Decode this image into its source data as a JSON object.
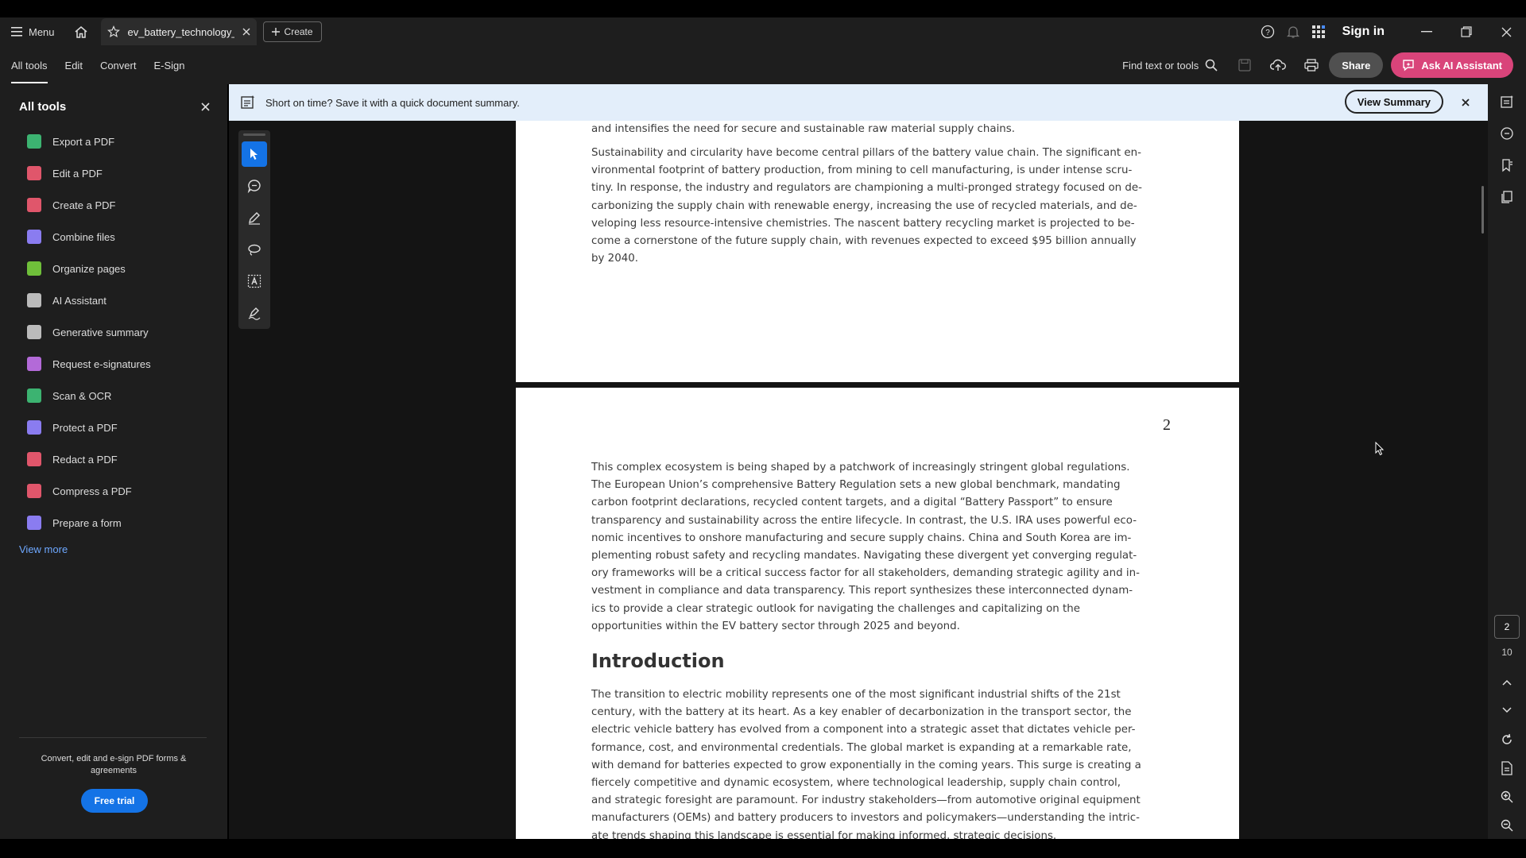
{
  "titlebar": {
    "menu_label": "Menu",
    "tab_title": "ev_battery_technology_...",
    "create_label": "Create",
    "sign_in": "Sign in"
  },
  "toolbar": {
    "tabs": [
      "All tools",
      "Edit",
      "Convert",
      "E-Sign"
    ],
    "find_label": "Find text or tools",
    "share_label": "Share",
    "ai_label": "Ask AI Assistant"
  },
  "sidebar": {
    "title": "All tools",
    "items": [
      {
        "label": "Export a PDF",
        "color": "#3cb371"
      },
      {
        "label": "Edit a PDF",
        "color": "#e0566b"
      },
      {
        "label": "Create a PDF",
        "color": "#e0566b"
      },
      {
        "label": "Combine files",
        "color": "#8a7cf0"
      },
      {
        "label": "Organize pages",
        "color": "#6fbf3a"
      },
      {
        "label": "AI Assistant",
        "color": "#bbbbbb"
      },
      {
        "label": "Generative summary",
        "color": "#bbbbbb"
      },
      {
        "label": "Request e-signatures",
        "color": "#b36ad8"
      },
      {
        "label": "Scan & OCR",
        "color": "#3cb371"
      },
      {
        "label": "Protect a PDF",
        "color": "#8a7cf0"
      },
      {
        "label": "Redact a PDF",
        "color": "#e0566b"
      },
      {
        "label": "Compress a PDF",
        "color": "#e0566b"
      },
      {
        "label": "Prepare a form",
        "color": "#8a7cf0"
      }
    ],
    "view_more": "View more",
    "promo": "Convert, edit and e-sign PDF forms & agreements",
    "free_trial": "Free trial"
  },
  "banner": {
    "text": "Short on time? Save it with a quick document summary.",
    "button": "View Summary"
  },
  "document": {
    "page1_paragraphs": [
      "and intensifies the need for secure and sustainable raw material supply chains.",
      "Sustainability and circularity have become central pillars of the battery value chain. The significant en-\nvironmental footprint of battery production, from mining to cell manufacturing, is under intense scru-\ntiny. In response, the industry and regulators are championing a multi-pronged strategy focused on de-\ncarbonizing the supply chain with renewable energy, increasing the use of recycled materials, and de-\nveloping less resource-intensive chemistries. The nascent battery recycling market is projected to be-\ncome a cornerstone of the future supply chain, with revenues expected to exceed $95 billion annually\nby 2040."
    ],
    "page2_number": "2",
    "page2_paragraph": "This complex ecosystem is being shaped by a patchwork of increasingly stringent global regulations.\nThe European Union’s comprehensive Battery Regulation sets a new global benchmark, mandating\ncarbon footprint declarations, recycled content targets, and a digital “Battery Passport” to ensure\ntransparency and sustainability across the entire lifecycle. In contrast, the U.S. IRA uses powerful eco-\nnomic incentives to onshore manufacturing and secure supply chains. China and South Korea are im-\nplementing robust safety and recycling mandates. Navigating these divergent yet converging regulat-\nory frameworks will be a critical success factor for all stakeholders, demanding strategic agility and in-\nvestment in compliance and data transparency. This report synthesizes these interconnected dynam-\nics to provide a clear strategic outlook for navigating the challenges and capitalizing on the\nopportunities within the EV battery sector through 2025 and beyond.",
    "heading": "Introduction",
    "intro_paragraph": "The transition to electric mobility represents one of the most significant industrial shifts of the 21st\ncentury, with the battery at its heart. As a key enabler of decarbonization in the transport sector, the\nelectric vehicle battery has evolved from a component into a strategic asset that dictates vehicle per-\nformance, cost, and environmental credentials. The global market is expanding at a remarkable rate,\nwith demand for batteries expected to grow exponentially in the coming years. This surge is creating a\nfiercely competitive and dynamic ecosystem, where technological leadership, supply chain control,\nand strategic foresight are paramount. For industry stakeholders—from automotive original equipment\nmanufacturers (OEMs) and battery producers to investors and policymakers—understanding the intric-\nate trends shaping this landscape is essential for making informed, strategic decisions."
  },
  "navigation": {
    "current_page": "2",
    "total_pages": "10"
  },
  "colors": {
    "accent_blue": "#1473e6",
    "ai_pink": "#d9447a",
    "banner_bg": "#e3eefa"
  }
}
